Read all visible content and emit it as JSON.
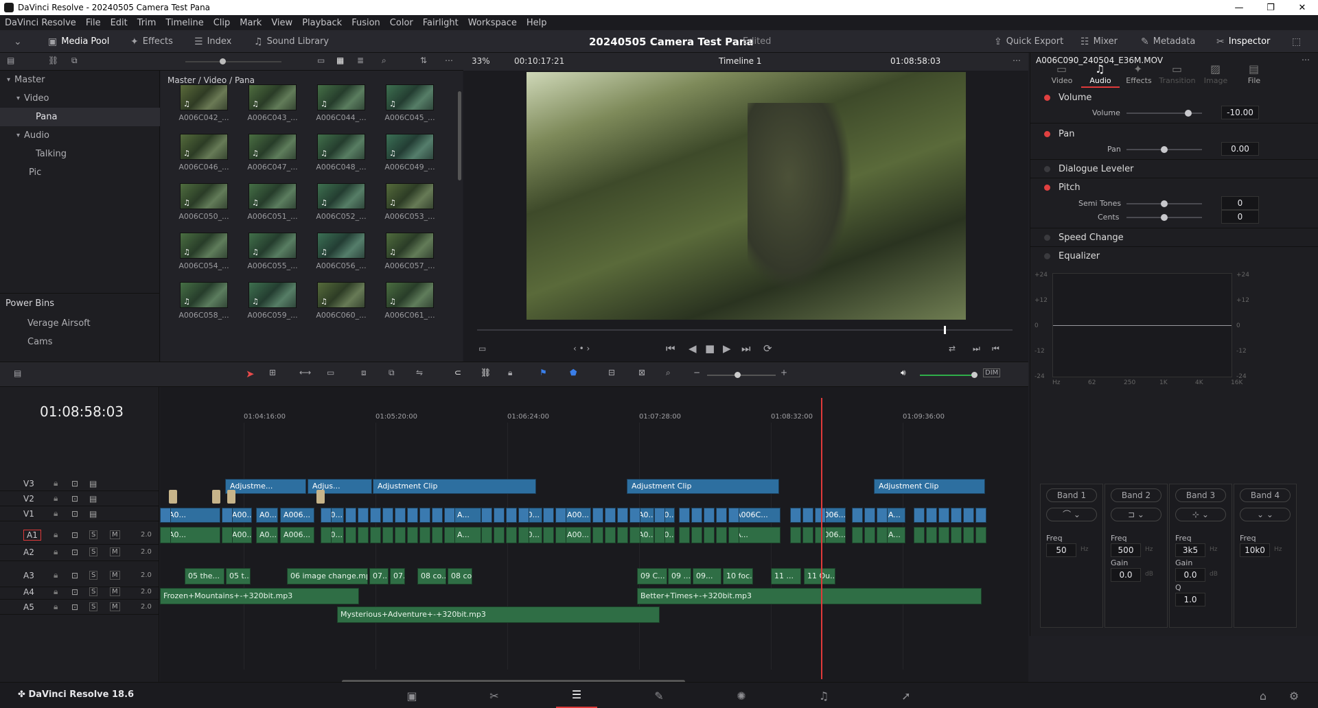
{
  "window": {
    "title": "DaVinci Resolve - 20240505 Camera Test Pana"
  },
  "menu": [
    "DaVinci Resolve",
    "File",
    "Edit",
    "Trim",
    "Timeline",
    "Clip",
    "Mark",
    "View",
    "Playback",
    "Fusion",
    "Color",
    "Fairlight",
    "Workspace",
    "Help"
  ],
  "toolbar": {
    "media_pool": "Media Pool",
    "effects": "Effects",
    "index": "Index",
    "sound_library": "Sound Library",
    "project": "20240505 Camera Test Pana",
    "state": "Edited",
    "quick_export": "Quick Export",
    "mixer": "Mixer",
    "metadata": "Metadata",
    "inspector": "Inspector"
  },
  "viewer": {
    "zoom": "33%",
    "duration": "00:10:17:21",
    "timeline": "Timeline 1",
    "timecode": "01:08:58:03"
  },
  "bins": {
    "master": "Master",
    "video": "Video",
    "pana": "Pana",
    "audio": "Audio",
    "talking": "Talking",
    "pic": "Pic",
    "power_bins": "Power Bins",
    "verage": "Verage Airsoft",
    "cams": "Cams"
  },
  "browser": {
    "path": "Master / Video / Pana",
    "clips": [
      "A006C042_...",
      "A006C043_...",
      "A006C044_...",
      "A006C045_...",
      "A006C046_...",
      "A006C047_...",
      "A006C048_...",
      "A006C049_...",
      "A006C050_...",
      "A006C051_...",
      "A006C052_...",
      "A006C053_...",
      "A006C054_...",
      "A006C055_...",
      "A006C056_...",
      "A006C057_...",
      "A006C058_...",
      "A006C059_...",
      "A006C060_...",
      "A006C061_..."
    ]
  },
  "inspector": {
    "clip": "A006C090_240504_E36M.MOV",
    "tabs": [
      "Video",
      "Audio",
      "Effects",
      "Transition",
      "Image",
      "File"
    ],
    "volume_hdr": "Volume",
    "volume_lbl": "Volume",
    "volume_val": "-10.00",
    "pan_hdr": "Pan",
    "pan_lbl": "Pan",
    "pan_val": "0.00",
    "dialogue": "Dialogue Leveler",
    "pitch": "Pitch",
    "semi": "Semi Tones",
    "semi_val": "0",
    "cents": "Cents",
    "cents_val": "0",
    "speed": "Speed Change",
    "eq": "Equalizer",
    "eq_y": [
      "+24",
      "+12",
      "0",
      "-12",
      "-24"
    ],
    "eq_x": [
      "Hz",
      "62",
      "250",
      "1K",
      "4K",
      "16K"
    ],
    "bands": [
      {
        "name": "Band 1",
        "freq": "50",
        "gain": "",
        "q": ""
      },
      {
        "name": "Band 2",
        "freq": "500",
        "gain": "0.0",
        "q": ""
      },
      {
        "name": "Band 3",
        "freq": "3k5",
        "gain": "0.0",
        "q": "1.0"
      },
      {
        "name": "Band 4",
        "freq": "10k0",
        "gain": "",
        "q": ""
      }
    ],
    "freq_lbl": "Freq",
    "gain_lbl": "Gain",
    "q_lbl": "Q",
    "hz": "Hz",
    "db": "dB"
  },
  "timeline": {
    "timecode": "01:08:58:03",
    "ticks": [
      "01:04:16:00",
      "01:05:20:00",
      "01:06:24:00",
      "01:07:28:00",
      "01:08:32:00",
      "01:09:36:00"
    ],
    "tracks": [
      {
        "name": "V3"
      },
      {
        "name": "V2"
      },
      {
        "name": "V1"
      },
      {
        "name": "A1",
        "vol": "2.0"
      },
      {
        "name": "A2",
        "vol": "2.0"
      },
      {
        "name": "A3",
        "vol": "2.0"
      },
      {
        "name": "A4",
        "vol": "2.0"
      },
      {
        "name": "A5",
        "vol": "2.0"
      }
    ],
    "adj": [
      "Adjustme...",
      "Adjus...",
      "Adjustment Clip",
      "Adjustment Clip",
      "Adjustment Clip"
    ],
    "a3": [
      "05 the...",
      "05 t...",
      "06 image change.mp3",
      "07...",
      "07...",
      "08 co...",
      "08 co...",
      "09 C...",
      "09 ...",
      "09...",
      "10 foc...",
      "11 ...",
      "11 Ou..."
    ],
    "a4_1": "Frozen+Mountains+-+320bit.mp3",
    "a4_2": "Better+Times+-+320bit.mp3",
    "a5": "Mysterious+Adventure+-+320bit.mp3",
    "v1": [
      "A0...",
      "A00...",
      "A0...",
      "A006...",
      "A0...",
      "A...",
      "A0...",
      "A00...",
      "A0...",
      "A0...",
      "A006C...",
      "A006...",
      "A..."
    ],
    "a1": [
      "A0...",
      "A00...",
      "A0...",
      "A006...",
      "A0...",
      "A...",
      "A0...",
      "A00...",
      "A0...",
      "A0...",
      "A...",
      "A006...",
      "A..."
    ]
  },
  "version": "DaVinci Resolve 18.6",
  "colors": {
    "accent": "#e03a3a",
    "video_clip": "#2f6f9f",
    "audio_clip": "#2f6e45"
  }
}
